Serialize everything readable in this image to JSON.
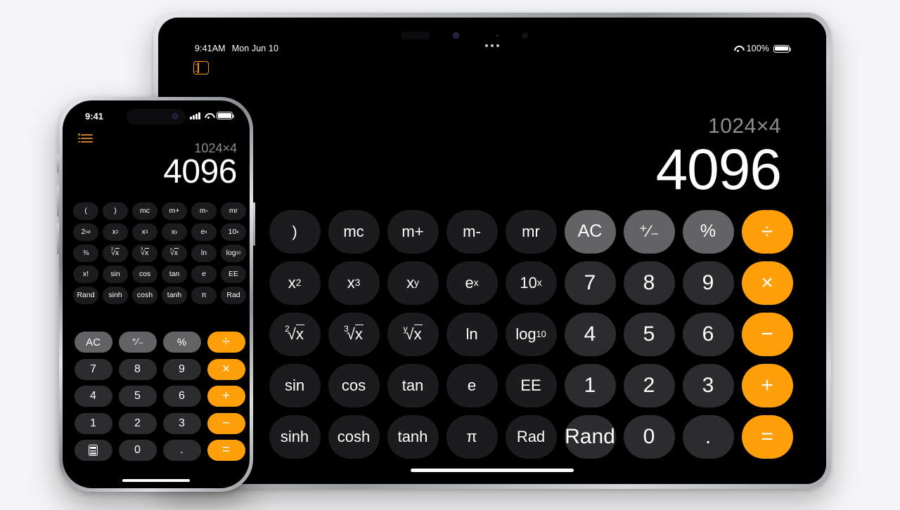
{
  "background_color": "#f5f5f7",
  "accent_color": "#ff9f0a",
  "ipad": {
    "status_bar": {
      "time": "9:41AM",
      "date": "Mon Jun 10",
      "battery_percent": "100%",
      "wifi_icon": "wifi-icon",
      "battery_icon": "battery-icon",
      "multitask_icon": "multitasking-dots-icon"
    },
    "sidebar_button_icon": "sidebar-toggle-icon",
    "display": {
      "expression": "1024×4",
      "result": "4096"
    },
    "keys": [
      {
        "label": ")",
        "type": "fn",
        "name": "close-paren"
      },
      {
        "label": "mc",
        "type": "fn",
        "name": "memory-clear"
      },
      {
        "label": "m+",
        "type": "fn",
        "name": "memory-add"
      },
      {
        "label": "m-",
        "type": "fn",
        "name": "memory-subtract"
      },
      {
        "label": "mr",
        "type": "fn",
        "name": "memory-recall"
      },
      {
        "label": "AC",
        "type": "util",
        "name": "all-clear"
      },
      {
        "label": "+/-",
        "type": "util",
        "name": "sign-toggle"
      },
      {
        "label": "%",
        "type": "util",
        "name": "percent"
      },
      {
        "label": "÷",
        "type": "op",
        "name": "divide"
      },
      {
        "label": "x2",
        "type": "fn",
        "name": "x-squared"
      },
      {
        "label": "x3",
        "type": "fn",
        "name": "x-cubed"
      },
      {
        "label": "xy",
        "type": "fn",
        "name": "x-power-y"
      },
      {
        "label": "ex",
        "type": "fn",
        "name": "e-power-x"
      },
      {
        "label": "10x",
        "type": "fn",
        "name": "ten-power-x"
      },
      {
        "label": "7",
        "type": "num",
        "name": "digit-7"
      },
      {
        "label": "8",
        "type": "num",
        "name": "digit-8"
      },
      {
        "label": "9",
        "type": "num",
        "name": "digit-9"
      },
      {
        "label": "×",
        "type": "op",
        "name": "multiply"
      },
      {
        "label": "2√x",
        "type": "fn",
        "name": "square-root"
      },
      {
        "label": "3√x",
        "type": "fn",
        "name": "cube-root"
      },
      {
        "label": "y√x",
        "type": "fn",
        "name": "y-root"
      },
      {
        "label": "ln",
        "type": "fn",
        "name": "natural-log"
      },
      {
        "label": "log10",
        "type": "fn",
        "name": "log-base-10"
      },
      {
        "label": "4",
        "type": "num",
        "name": "digit-4"
      },
      {
        "label": "5",
        "type": "num",
        "name": "digit-5"
      },
      {
        "label": "6",
        "type": "num",
        "name": "digit-6"
      },
      {
        "label": "−",
        "type": "op",
        "name": "subtract"
      },
      {
        "label": "sin",
        "type": "fn",
        "name": "sine"
      },
      {
        "label": "cos",
        "type": "fn",
        "name": "cosine"
      },
      {
        "label": "tan",
        "type": "fn",
        "name": "tangent"
      },
      {
        "label": "e",
        "type": "fn",
        "name": "euler-constant"
      },
      {
        "label": "EE",
        "type": "fn",
        "name": "exponent-entry"
      },
      {
        "label": "1",
        "type": "num",
        "name": "digit-1"
      },
      {
        "label": "2",
        "type": "num",
        "name": "digit-2"
      },
      {
        "label": "3",
        "type": "num",
        "name": "digit-3"
      },
      {
        "label": "+",
        "type": "op",
        "name": "add"
      },
      {
        "label": "sinh",
        "type": "fn",
        "name": "hyperbolic-sine"
      },
      {
        "label": "cosh",
        "type": "fn",
        "name": "hyperbolic-cosine"
      },
      {
        "label": "tanh",
        "type": "fn",
        "name": "hyperbolic-tangent"
      },
      {
        "label": "π",
        "type": "fn",
        "name": "pi"
      },
      {
        "label": "Rad",
        "type": "fn",
        "name": "radians-toggle"
      },
      {
        "label": "Rand",
        "type": "num",
        "name": "random"
      },
      {
        "label": "0",
        "type": "num",
        "name": "digit-0"
      },
      {
        "label": ".",
        "type": "num",
        "name": "decimal-point"
      },
      {
        "label": "=",
        "type": "op",
        "name": "equals"
      }
    ]
  },
  "iphone": {
    "status_bar": {
      "time": "9:41",
      "signal_icon": "cellular-signal-icon",
      "wifi_icon": "wifi-icon",
      "battery_icon": "battery-icon"
    },
    "menu_button_icon": "list-menu-icon",
    "display": {
      "expression": "1024×4",
      "result": "4096"
    },
    "sci_keys": [
      {
        "label": "(",
        "name": "open-paren"
      },
      {
        "label": ")",
        "name": "close-paren"
      },
      {
        "label": "mc",
        "name": "memory-clear"
      },
      {
        "label": "m+",
        "name": "memory-add"
      },
      {
        "label": "m-",
        "name": "memory-subtract"
      },
      {
        "label": "mr",
        "name": "memory-recall"
      },
      {
        "label": "2nd",
        "name": "second-function"
      },
      {
        "label": "x2",
        "name": "x-squared"
      },
      {
        "label": "x3",
        "name": "x-cubed"
      },
      {
        "label": "xy",
        "name": "x-power-y"
      },
      {
        "label": "ex",
        "name": "e-power-x"
      },
      {
        "label": "10x",
        "name": "ten-power-x"
      },
      {
        "label": "1/x",
        "name": "reciprocal"
      },
      {
        "label": "2√x",
        "name": "square-root"
      },
      {
        "label": "3√x",
        "name": "cube-root"
      },
      {
        "label": "y√x",
        "name": "y-root"
      },
      {
        "label": "ln",
        "name": "natural-log"
      },
      {
        "label": "log10",
        "name": "log-base-10"
      },
      {
        "label": "x!",
        "name": "factorial"
      },
      {
        "label": "sin",
        "name": "sine"
      },
      {
        "label": "cos",
        "name": "cosine"
      },
      {
        "label": "tan",
        "name": "tangent"
      },
      {
        "label": "e",
        "name": "euler-constant"
      },
      {
        "label": "EE",
        "name": "exponent-entry"
      },
      {
        "label": "Rand",
        "name": "random"
      },
      {
        "label": "sinh",
        "name": "hyperbolic-sine"
      },
      {
        "label": "cosh",
        "name": "hyperbolic-cosine"
      },
      {
        "label": "tanh",
        "name": "hyperbolic-tangent"
      },
      {
        "label": "π",
        "name": "pi"
      },
      {
        "label": "Rad",
        "name": "radians-toggle"
      }
    ],
    "pad_keys": [
      {
        "label": "AC",
        "type": "util",
        "name": "all-clear"
      },
      {
        "label": "+/-",
        "type": "util",
        "name": "sign-toggle"
      },
      {
        "label": "%",
        "type": "util",
        "name": "percent"
      },
      {
        "label": "÷",
        "type": "op",
        "name": "divide"
      },
      {
        "label": "7",
        "type": "num",
        "name": "digit-7"
      },
      {
        "label": "8",
        "type": "num",
        "name": "digit-8"
      },
      {
        "label": "9",
        "type": "num",
        "name": "digit-9"
      },
      {
        "label": "×",
        "type": "op",
        "name": "multiply"
      },
      {
        "label": "4",
        "type": "num",
        "name": "digit-4"
      },
      {
        "label": "5",
        "type": "num",
        "name": "digit-5"
      },
      {
        "label": "6",
        "type": "num",
        "name": "digit-6"
      },
      {
        "label": "+",
        "type": "op",
        "name": "add"
      },
      {
        "label": "1",
        "type": "num",
        "name": "digit-1"
      },
      {
        "label": "2",
        "type": "num",
        "name": "digit-2"
      },
      {
        "label": "3",
        "type": "num",
        "name": "digit-3"
      },
      {
        "label": "−",
        "type": "op",
        "name": "subtract"
      },
      {
        "label": "calculator-icon",
        "type": "num",
        "name": "calculator-mode"
      },
      {
        "label": "0",
        "type": "num",
        "name": "digit-0"
      },
      {
        "label": ".",
        "type": "num",
        "name": "decimal-point"
      },
      {
        "label": "=",
        "type": "op",
        "name": "equals"
      }
    ]
  }
}
